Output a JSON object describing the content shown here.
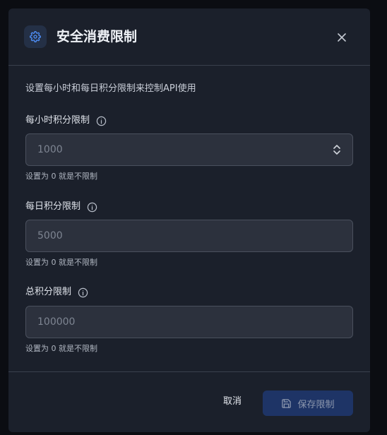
{
  "dialog": {
    "title": "安全消费限制",
    "description": "设置每小时和每日积分限制来控制API使用",
    "icons": {
      "header": "gear-icon",
      "close": "close-icon",
      "info": "info-icon",
      "save": "save-icon"
    },
    "colors": {
      "accent": "#3b82f6",
      "save_button_bg": "#1e3466"
    }
  },
  "fields": [
    {
      "label": "每小时积分限制",
      "placeholder": "1000",
      "value": "",
      "hint": "设置为 0 就是不限制"
    },
    {
      "label": "每日积分限制",
      "placeholder": "5000",
      "value": "",
      "hint": "设置为 0 就是不限制"
    },
    {
      "label": "总积分限制",
      "placeholder": "100000",
      "value": "",
      "hint": "设置为 0 就是不限制"
    }
  ],
  "footer": {
    "cancel_label": "取消",
    "save_label": "保存限制"
  }
}
